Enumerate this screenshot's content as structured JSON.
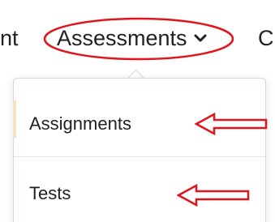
{
  "nav": {
    "prev_fragment": "nt",
    "current_label": "Assessments",
    "next_fragment": "C",
    "chevron_icon": "chevron-down-icon"
  },
  "dropdown": {
    "items": [
      {
        "label": "Assignments"
      },
      {
        "label": "Tests"
      }
    ]
  },
  "annotations": {
    "highlight_color": "#e0141c",
    "ellipse": "ellipse-highlight",
    "arrow_icon": "left-arrow-icon"
  }
}
